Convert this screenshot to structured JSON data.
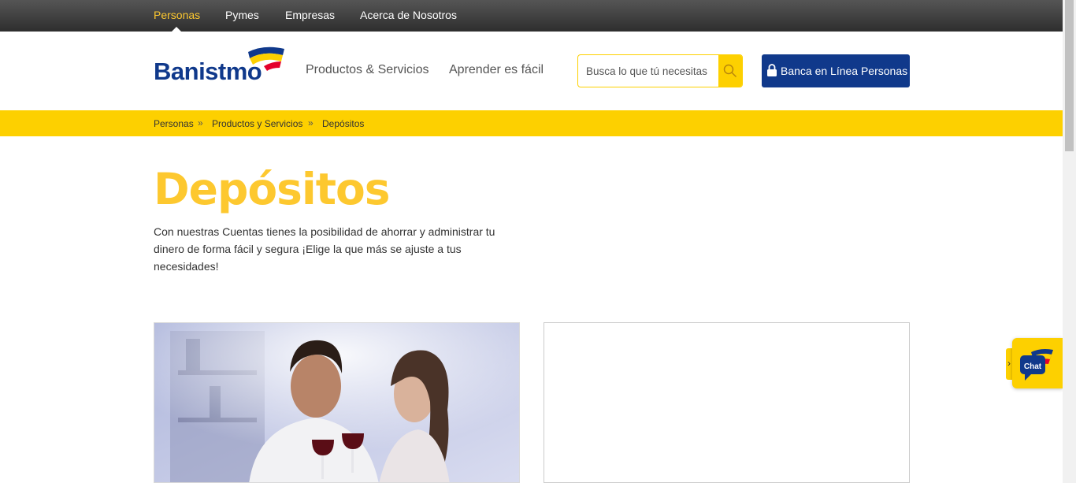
{
  "topnav": {
    "items": [
      {
        "label": "Personas",
        "active": true
      },
      {
        "label": "Pymes"
      },
      {
        "label": "Empresas"
      },
      {
        "label": "Acerca de Nosotros"
      }
    ]
  },
  "header": {
    "logo_text": "Banistmo",
    "nav": [
      "Productos & Servicios",
      "Aprender es fácil"
    ],
    "search_placeholder": "Busca lo que tú necesitas",
    "bank_button": "Banca en Línea Personas"
  },
  "breadcrumb": {
    "items": [
      "Personas",
      "Productos y Servicios",
      "Depósitos"
    ],
    "separator": "»"
  },
  "main": {
    "title": "Depósitos",
    "description": "Con nuestras Cuentas tienes la posibilidad de ahorrar y administrar tu dinero de forma fácil y segura ¡Elige la que más se ajuste a tus necesidades!"
  },
  "chat": {
    "label": "Chat",
    "tab_glyph": "›"
  },
  "colors": {
    "brand_blue": "#10398b",
    "brand_yellow": "#fdd000",
    "title_yellow": "#fdc82f",
    "brand_red": "#e4002b"
  },
  "icons": [
    "search-icon",
    "lock-icon",
    "chat-icon",
    "chevron-right-icon"
  ]
}
